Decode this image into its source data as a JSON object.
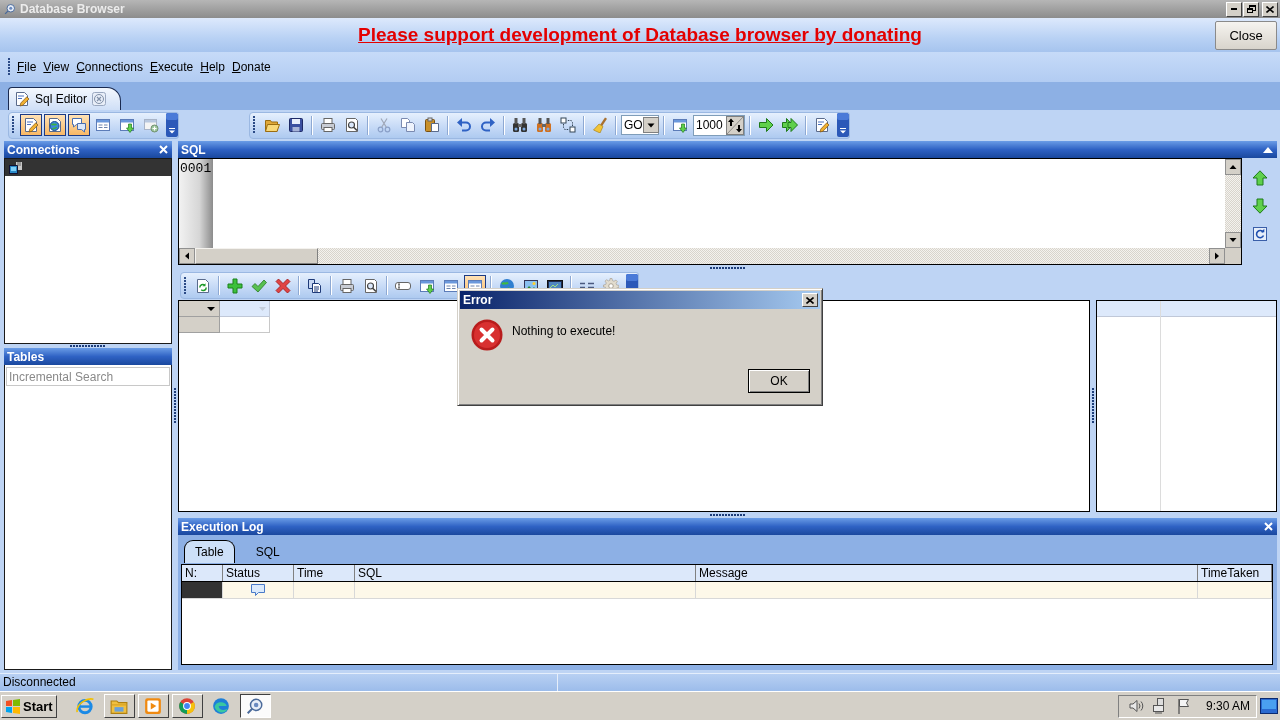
{
  "window": {
    "title": "Database Browser"
  },
  "banner": {
    "link": "Please support development of Database browser by donating",
    "close_button": "Close"
  },
  "menu": [
    {
      "label": "File"
    },
    {
      "label": "View"
    },
    {
      "label": "Connections"
    },
    {
      "label": "Execute"
    },
    {
      "label": "Help"
    },
    {
      "label": "Donate"
    }
  ],
  "document_tabs": [
    {
      "label": "Sql Editor",
      "selected": true
    }
  ],
  "toolbar": {
    "toggles": [
      {
        "on": true
      },
      {
        "on": true
      },
      {
        "on": true
      }
    ],
    "execute_mode": {
      "value": "GO"
    },
    "row_limit": {
      "value": "1000"
    }
  },
  "connections": {
    "title": "Connections",
    "items": [
      {
        "selected": true
      }
    ]
  },
  "tables": {
    "title": "Tables",
    "search": {
      "placeholder": "Incremental Search"
    }
  },
  "sql": {
    "title": "SQL",
    "line_numbers": [
      "0001"
    ]
  },
  "results": {
    "toggles": [
      {
        "on": true
      }
    ]
  },
  "execution_log": {
    "title": "Execution Log",
    "tabs": [
      {
        "label": "Table",
        "selected": true
      },
      {
        "label": "SQL",
        "selected": false
      }
    ],
    "columns": [
      "N:",
      "Status",
      "Time",
      "SQL",
      "Message",
      "TimeTaken"
    ],
    "rows": [
      {
        "selected": true
      }
    ]
  },
  "status_bar": {
    "text": "Disconnected"
  },
  "taskbar": {
    "start": "Start",
    "apps": [
      {
        "running": false,
        "selected": false
      },
      {
        "running": true,
        "selected": false
      },
      {
        "running": true,
        "selected": false
      },
      {
        "running": true,
        "selected": false
      },
      {
        "running": false,
        "selected": false
      },
      {
        "running": true,
        "selected": true
      }
    ],
    "clock": "9:30 AM"
  },
  "dialog": {
    "title": "Error",
    "message": "Nothing to execute!",
    "button": "OK"
  }
}
